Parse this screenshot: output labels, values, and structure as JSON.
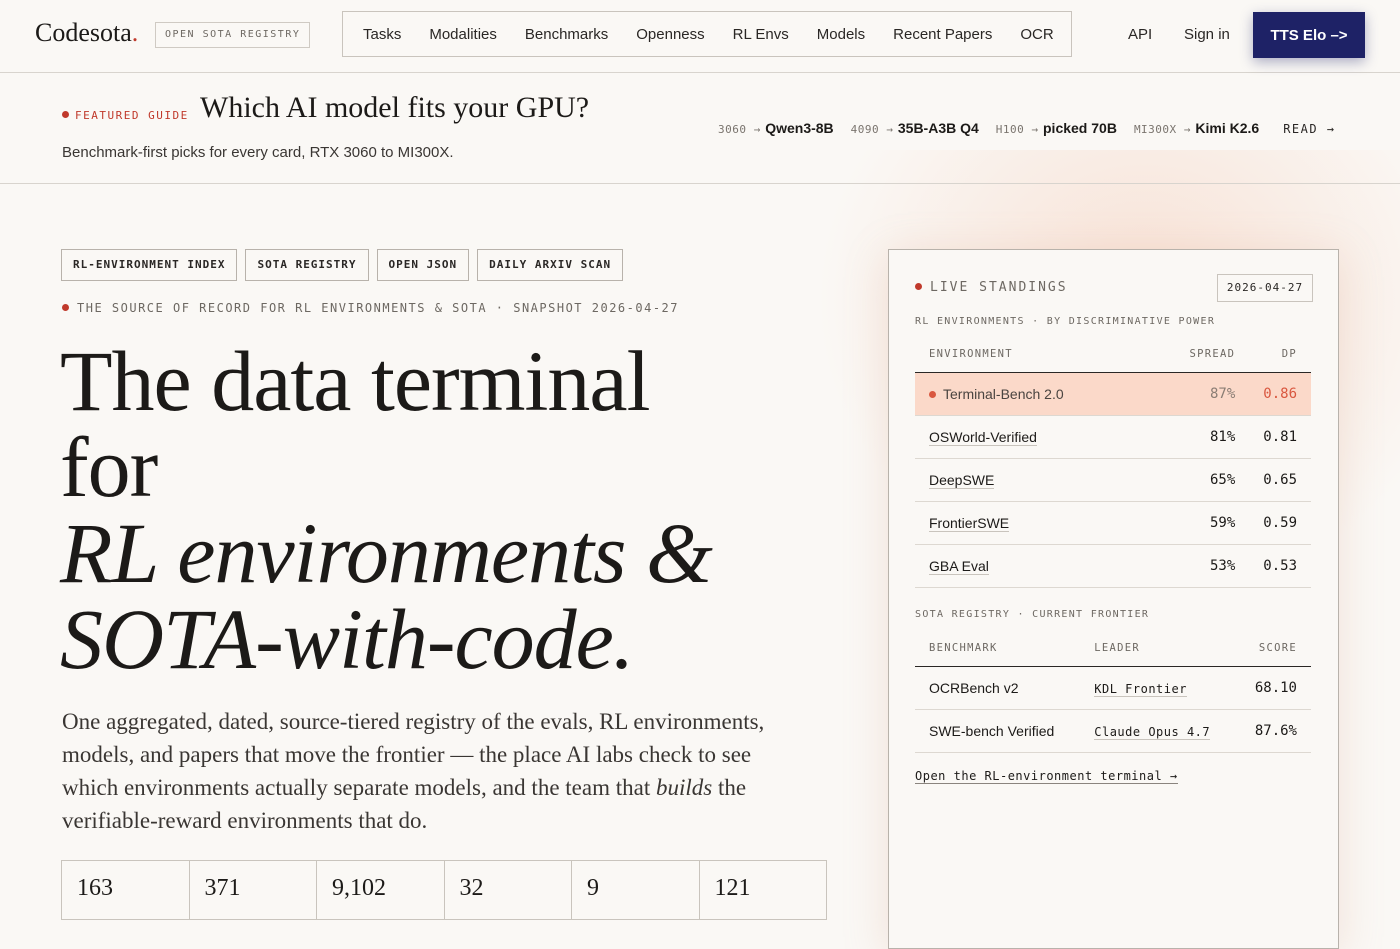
{
  "header": {
    "logo": "Codesota",
    "logo_dot": ".",
    "registry_badge": "OPEN SOTA REGISTRY",
    "nav": [
      "Tasks",
      "Modalities",
      "Benchmarks",
      "Openness",
      "RL Envs",
      "Models",
      "Recent Papers",
      "OCR"
    ],
    "api": "API",
    "sign_in": "Sign in",
    "cta": "TTS Elo  –>"
  },
  "featured": {
    "label": "FEATURED GUIDE",
    "title": "Which AI model fits your GPU?",
    "subtitle": "Benchmark-first picks for every card, RTX 3060 to MI300X.",
    "picks": [
      {
        "gpu": "3060 →",
        "model": "Qwen3-8B"
      },
      {
        "gpu": "4090 →",
        "model": "35B-A3B Q4"
      },
      {
        "gpu": "H100 →",
        "model": "picked 70B"
      },
      {
        "gpu": "MI300X →",
        "model": "Kimi K2.6"
      }
    ],
    "read": "READ →"
  },
  "hero": {
    "tags": [
      "RL-ENVIRONMENT INDEX",
      "SOTA REGISTRY",
      "OPEN JSON",
      "DAILY ARXIV SCAN"
    ],
    "source_line": "THE SOURCE OF RECORD FOR RL ENVIRONMENTS & SOTA · SNAPSHOT 2026-04-27",
    "headline_1": "The data terminal",
    "headline_2": "for",
    "headline_3": "RL environments &",
    "headline_4": "SOTA-with-code.",
    "lede_a": "One aggregated, dated, source-tiered registry of the evals, RL environments, models, and papers that move the frontier — the place AI labs check to see which environments actually separate models, and the team that ",
    "lede_em": "builds",
    "lede_b": " the verifiable-reward environments that do.",
    "stats": [
      "163",
      "371",
      "9,102",
      "32",
      "9",
      "121"
    ]
  },
  "panel": {
    "live_label": "LIVE STANDINGS",
    "date": "2026-04-27",
    "env_section": "RL ENVIRONMENTS · BY DISCRIMINATIVE POWER",
    "env_headers": {
      "env": "ENVIRONMENT",
      "spread": "SPREAD",
      "dp": "DP"
    },
    "environments": [
      {
        "name": "Terminal-Bench 2.0",
        "spread": "87%",
        "dp": "0.86"
      },
      {
        "name": "OSWorld-Verified",
        "spread": "81%",
        "dp": "0.81"
      },
      {
        "name": "DeepSWE",
        "spread": "65%",
        "dp": "0.65"
      },
      {
        "name": "FrontierSWE",
        "spread": "59%",
        "dp": "0.59"
      },
      {
        "name": "GBA Eval",
        "spread": "53%",
        "dp": "0.53"
      }
    ],
    "sota_section": "SOTA REGISTRY · CURRENT FRONTIER",
    "sota_headers": {
      "benchmark": "BENCHMARK",
      "leader": "LEADER",
      "score": "SCORE"
    },
    "sota": [
      {
        "benchmark": "OCRBench v2",
        "leader": "KDL Frontier",
        "score": "68.10"
      },
      {
        "benchmark": "SWE-bench Verified",
        "leader": "Claude Opus 4.7",
        "score": "87.6%"
      }
    ],
    "open_link": "Open the RL-environment terminal →"
  }
}
